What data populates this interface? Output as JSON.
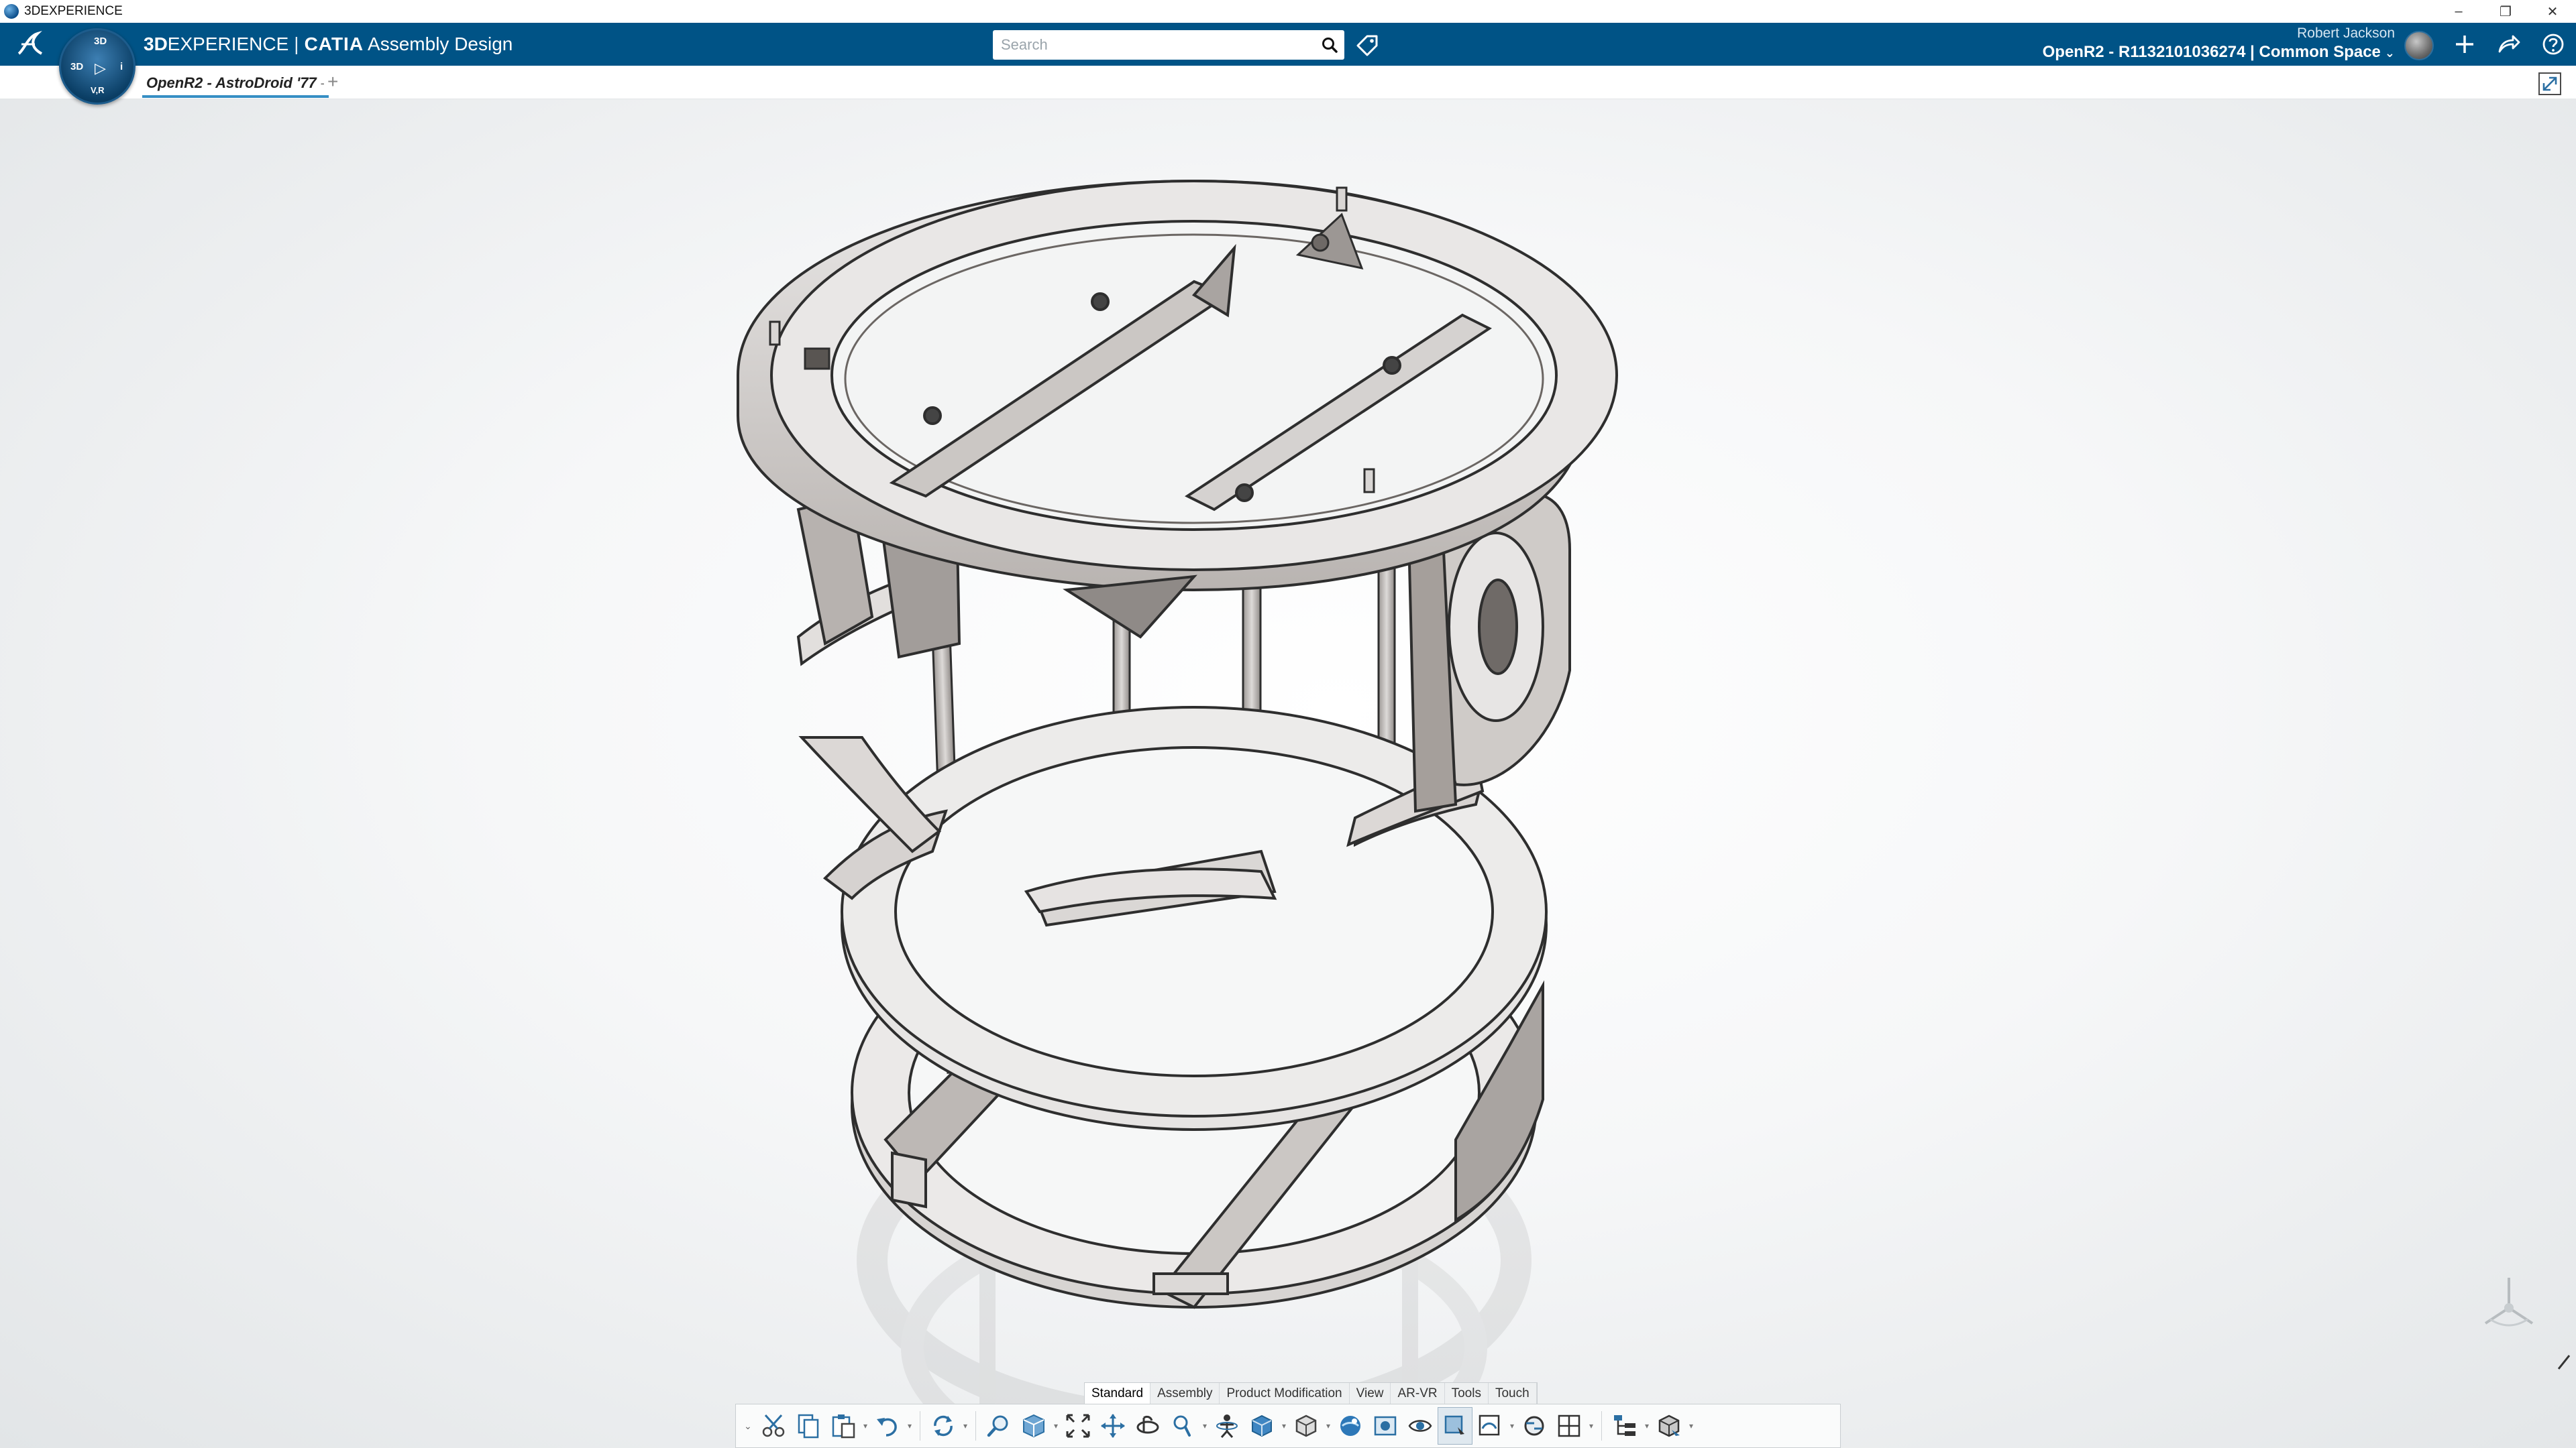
{
  "window": {
    "title": "3DEXPERIENCE"
  },
  "app_bar": {
    "brand_bold": "3D",
    "brand_rest": "EXPERIENCE",
    "separator": "|",
    "product": "CATIA",
    "app_name": "Assembly Design",
    "search": {
      "placeholder": "Search",
      "value": ""
    },
    "user_name": "Robert Jackson",
    "context": "OpenR2 - R1132101036274 | Common Space"
  },
  "compass": {
    "top": "3D",
    "left": "3D",
    "center": "▷",
    "right": "i",
    "bottom": "V,R"
  },
  "tabs": {
    "document_title": "OpenR2 - AstroDroid '77",
    "menu_glyph": "-",
    "add_glyph": "+"
  },
  "action_bar": {
    "section_tabs": [
      "Standard",
      "Assembly",
      "Product Modification",
      "View",
      "AR-VR",
      "Tools",
      "Touch"
    ],
    "active_section": "Standard"
  },
  "colors": {
    "app_bar": "#005386",
    "tab_underline": "#368ec4",
    "part_fill": "#e4e2e1",
    "part_shade": "#a9a4a1",
    "edge": "#2e2e2e"
  },
  "icons": [
    "search-icon",
    "tag-icon",
    "add-icon",
    "share-icon",
    "help-icon",
    "fullscreen-icon",
    "cut-icon",
    "copy-icon",
    "paste-icon",
    "undo-icon",
    "update-icon",
    "zoom-icon",
    "fit-all-icon",
    "pan-icon",
    "rotate-icon",
    "view-mode-icon",
    "render-icon"
  ]
}
